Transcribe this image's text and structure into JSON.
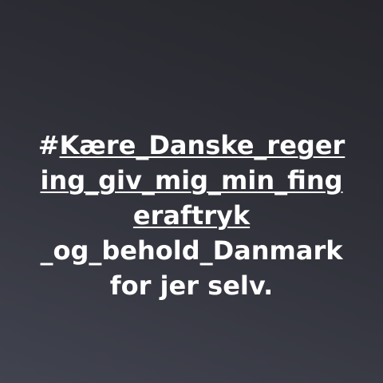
{
  "post": {
    "lines": [
      {
        "prefix": "#",
        "link": "Kære_Danske_reger"
      },
      {
        "prefix": "",
        "link": "ing_giv_mig_min_fing"
      },
      {
        "prefix": "",
        "link": "eraftryk"
      },
      {
        "prefix": "",
        "link": "_og_behold_Danmark"
      },
      {
        "prefix": "for jer selv.",
        "link": ""
      }
    ]
  }
}
